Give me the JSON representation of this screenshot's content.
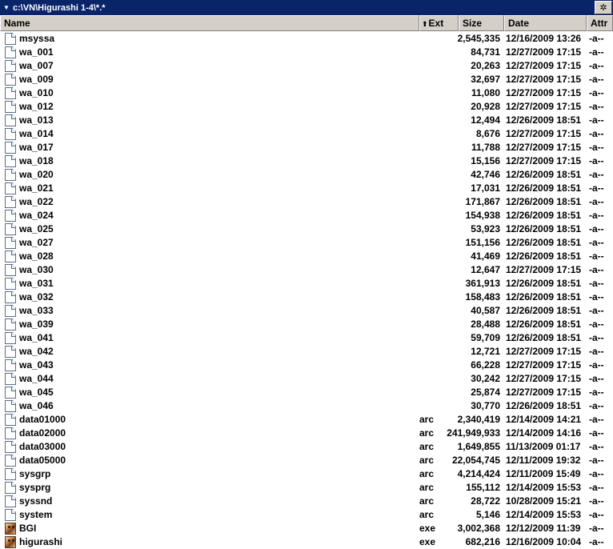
{
  "window": {
    "path": "c:\\VN\\Higurashi 1-4\\*.*",
    "options_glyph": "✲"
  },
  "columns": {
    "name": "Name",
    "ext": "Ext",
    "size": "Size",
    "date": "Date",
    "attr": "Attr",
    "sort_glyph": "⬆"
  },
  "files": [
    {
      "name": "msyssa",
      "ext": "",
      "size": "2,545,335",
      "date": "12/16/2009 13:26",
      "attr": "-a--",
      "icon": "document-icon"
    },
    {
      "name": "wa_001",
      "ext": "",
      "size": "84,731",
      "date": "12/27/2009 17:15",
      "attr": "-a--",
      "icon": "document-icon"
    },
    {
      "name": "wa_007",
      "ext": "",
      "size": "20,263",
      "date": "12/27/2009 17:15",
      "attr": "-a--",
      "icon": "document-icon"
    },
    {
      "name": "wa_009",
      "ext": "",
      "size": "32,697",
      "date": "12/27/2009 17:15",
      "attr": "-a--",
      "icon": "document-icon"
    },
    {
      "name": "wa_010",
      "ext": "",
      "size": "11,080",
      "date": "12/27/2009 17:15",
      "attr": "-a--",
      "icon": "document-icon"
    },
    {
      "name": "wa_012",
      "ext": "",
      "size": "20,928",
      "date": "12/27/2009 17:15",
      "attr": "-a--",
      "icon": "document-icon"
    },
    {
      "name": "wa_013",
      "ext": "",
      "size": "12,494",
      "date": "12/26/2009 18:51",
      "attr": "-a--",
      "icon": "document-icon"
    },
    {
      "name": "wa_014",
      "ext": "",
      "size": "8,676",
      "date": "12/27/2009 17:15",
      "attr": "-a--",
      "icon": "document-icon"
    },
    {
      "name": "wa_017",
      "ext": "",
      "size": "11,788",
      "date": "12/27/2009 17:15",
      "attr": "-a--",
      "icon": "document-icon"
    },
    {
      "name": "wa_018",
      "ext": "",
      "size": "15,156",
      "date": "12/27/2009 17:15",
      "attr": "-a--",
      "icon": "document-icon"
    },
    {
      "name": "wa_020",
      "ext": "",
      "size": "42,746",
      "date": "12/26/2009 18:51",
      "attr": "-a--",
      "icon": "document-icon"
    },
    {
      "name": "wa_021",
      "ext": "",
      "size": "17,031",
      "date": "12/26/2009 18:51",
      "attr": "-a--",
      "icon": "document-icon"
    },
    {
      "name": "wa_022",
      "ext": "",
      "size": "171,867",
      "date": "12/26/2009 18:51",
      "attr": "-a--",
      "icon": "document-icon"
    },
    {
      "name": "wa_024",
      "ext": "",
      "size": "154,938",
      "date": "12/26/2009 18:51",
      "attr": "-a--",
      "icon": "document-icon"
    },
    {
      "name": "wa_025",
      "ext": "",
      "size": "53,923",
      "date": "12/26/2009 18:51",
      "attr": "-a--",
      "icon": "document-icon"
    },
    {
      "name": "wa_027",
      "ext": "",
      "size": "151,156",
      "date": "12/26/2009 18:51",
      "attr": "-a--",
      "icon": "document-icon"
    },
    {
      "name": "wa_028",
      "ext": "",
      "size": "41,469",
      "date": "12/26/2009 18:51",
      "attr": "-a--",
      "icon": "document-icon"
    },
    {
      "name": "wa_030",
      "ext": "",
      "size": "12,647",
      "date": "12/27/2009 17:15",
      "attr": "-a--",
      "icon": "document-icon"
    },
    {
      "name": "wa_031",
      "ext": "",
      "size": "361,913",
      "date": "12/26/2009 18:51",
      "attr": "-a--",
      "icon": "document-icon"
    },
    {
      "name": "wa_032",
      "ext": "",
      "size": "158,483",
      "date": "12/26/2009 18:51",
      "attr": "-a--",
      "icon": "document-icon"
    },
    {
      "name": "wa_033",
      "ext": "",
      "size": "40,587",
      "date": "12/26/2009 18:51",
      "attr": "-a--",
      "icon": "document-icon"
    },
    {
      "name": "wa_039",
      "ext": "",
      "size": "28,488",
      "date": "12/26/2009 18:51",
      "attr": "-a--",
      "icon": "document-icon"
    },
    {
      "name": "wa_041",
      "ext": "",
      "size": "59,709",
      "date": "12/26/2009 18:51",
      "attr": "-a--",
      "icon": "document-icon"
    },
    {
      "name": "wa_042",
      "ext": "",
      "size": "12,721",
      "date": "12/27/2009 17:15",
      "attr": "-a--",
      "icon": "document-icon"
    },
    {
      "name": "wa_043",
      "ext": "",
      "size": "66,228",
      "date": "12/27/2009 17:15",
      "attr": "-a--",
      "icon": "document-icon"
    },
    {
      "name": "wa_044",
      "ext": "",
      "size": "30,242",
      "date": "12/27/2009 17:15",
      "attr": "-a--",
      "icon": "document-icon"
    },
    {
      "name": "wa_045",
      "ext": "",
      "size": "25,874",
      "date": "12/27/2009 17:15",
      "attr": "-a--",
      "icon": "document-icon"
    },
    {
      "name": "wa_046",
      "ext": "",
      "size": "30,770",
      "date": "12/26/2009 18:51",
      "attr": "-a--",
      "icon": "document-icon"
    },
    {
      "name": "data01000",
      "ext": "arc",
      "size": "2,340,419",
      "date": "12/14/2009 14:21",
      "attr": "-a--",
      "icon": "document-icon"
    },
    {
      "name": "data02000",
      "ext": "arc",
      "size": "241,949,933",
      "date": "12/14/2009 14:16",
      "attr": "-a--",
      "icon": "document-icon"
    },
    {
      "name": "data03000",
      "ext": "arc",
      "size": "1,649,855",
      "date": "11/13/2009 01:17",
      "attr": "-a--",
      "icon": "document-icon"
    },
    {
      "name": "data05000",
      "ext": "arc",
      "size": "22,054,745",
      "date": "12/11/2009 19:32",
      "attr": "-a--",
      "icon": "document-icon"
    },
    {
      "name": "sysgrp",
      "ext": "arc",
      "size": "4,214,424",
      "date": "12/11/2009 15:49",
      "attr": "-a--",
      "icon": "document-icon"
    },
    {
      "name": "sysprg",
      "ext": "arc",
      "size": "155,112",
      "date": "12/14/2009 15:53",
      "attr": "-a--",
      "icon": "document-icon"
    },
    {
      "name": "syssnd",
      "ext": "arc",
      "size": "28,722",
      "date": "10/28/2009 15:21",
      "attr": "-a--",
      "icon": "document-icon"
    },
    {
      "name": "system",
      "ext": "arc",
      "size": "5,146",
      "date": "12/14/2009 15:53",
      "attr": "-a--",
      "icon": "document-icon"
    },
    {
      "name": "BGI",
      "ext": "exe",
      "size": "3,002,368",
      "date": "12/12/2009 11:39",
      "attr": "-a--",
      "icon": "exe-icon"
    },
    {
      "name": "higurashi",
      "ext": "exe",
      "size": "682,216",
      "date": "12/16/2009 10:04",
      "attr": "-a--",
      "icon": "exe-icon"
    }
  ]
}
